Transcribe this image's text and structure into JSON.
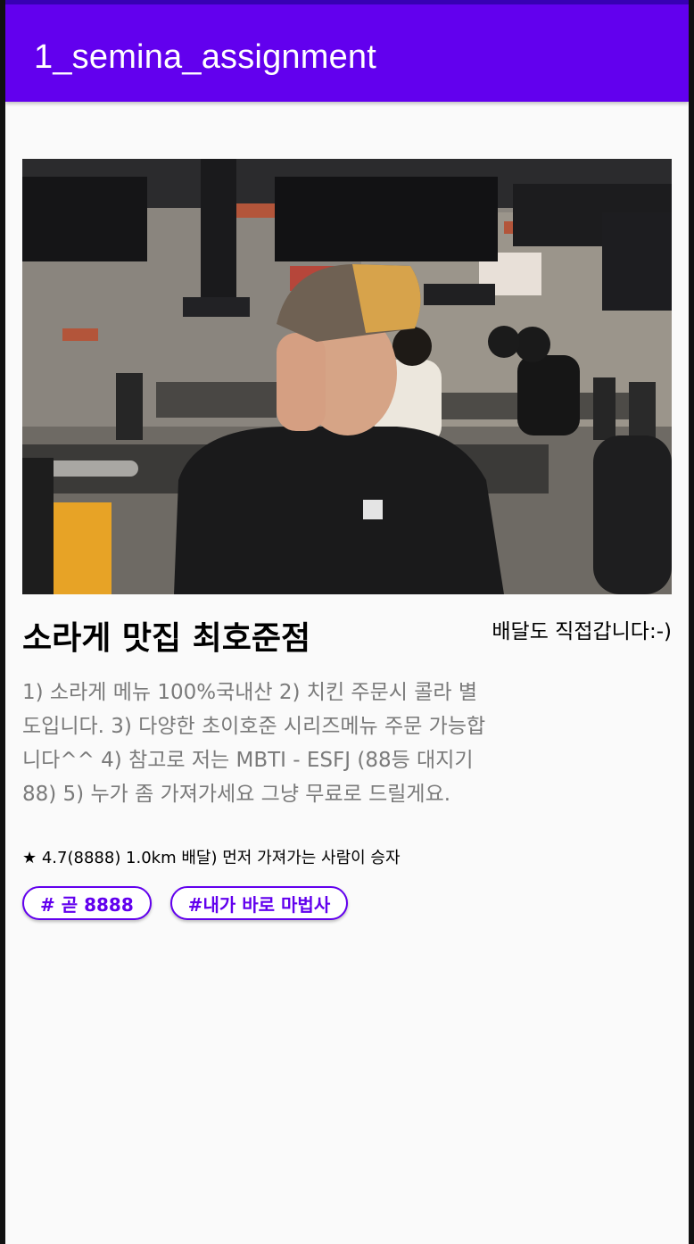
{
  "app_bar": {
    "title": "1_semina_assignment"
  },
  "store": {
    "photo_icon": "restaurant-photo",
    "title": "소라게 맛집 최호준점",
    "delivery_note": "배달도 직접갑니다:-)",
    "description": "1) 소라게 메뉴 100%국내산 2) 치킨 주문시 콜라 별도입니다. 3) 다양한 초이호준 시리즈메뉴 주문 가능합니다^^ 4) 참고로 저는 MBTI - ESFJ (88등 대지기88) 5) 누가 좀 가져가세요  그냥 무료로 드릴게요.",
    "meta": "★ 4.7(8888) 1.0km 배달) 먼저 가져가는 사람이 승자",
    "tags": [
      "# 곧 8888",
      "#내가 바로 마법사"
    ]
  },
  "colors": {
    "primary": "#6200ee",
    "primary_dark": "#3700b3",
    "background": "#fafafa",
    "secondary_text": "#7a7a7a"
  }
}
